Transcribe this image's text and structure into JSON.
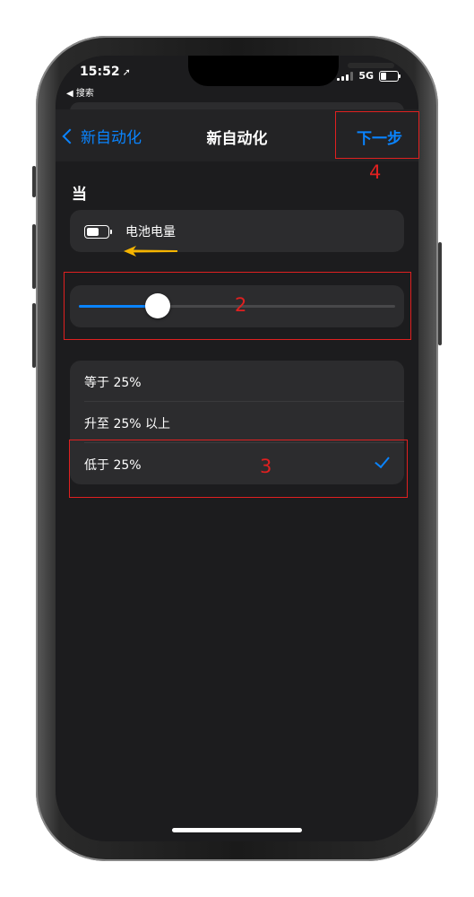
{
  "status_bar": {
    "time": "15:52",
    "back_app": "◀ 搜索",
    "network": "5G"
  },
  "nav": {
    "back_label": "新自动化",
    "title": "新自动化",
    "next_label": "下一步"
  },
  "trigger": {
    "section_label": "当",
    "condition_label": "电池电量"
  },
  "slider": {
    "value_percent": 25
  },
  "options": [
    {
      "label": "等于 25%",
      "selected": false
    },
    {
      "label": "升至 25% 以上",
      "selected": false
    },
    {
      "label": "低于 25%",
      "selected": true
    }
  ],
  "annotations": {
    "step2": "2",
    "step3": "3",
    "step4": "4"
  },
  "colors": {
    "accent": "#0a84ff",
    "annotation": "#e02020",
    "arrow": "#f5b400"
  }
}
